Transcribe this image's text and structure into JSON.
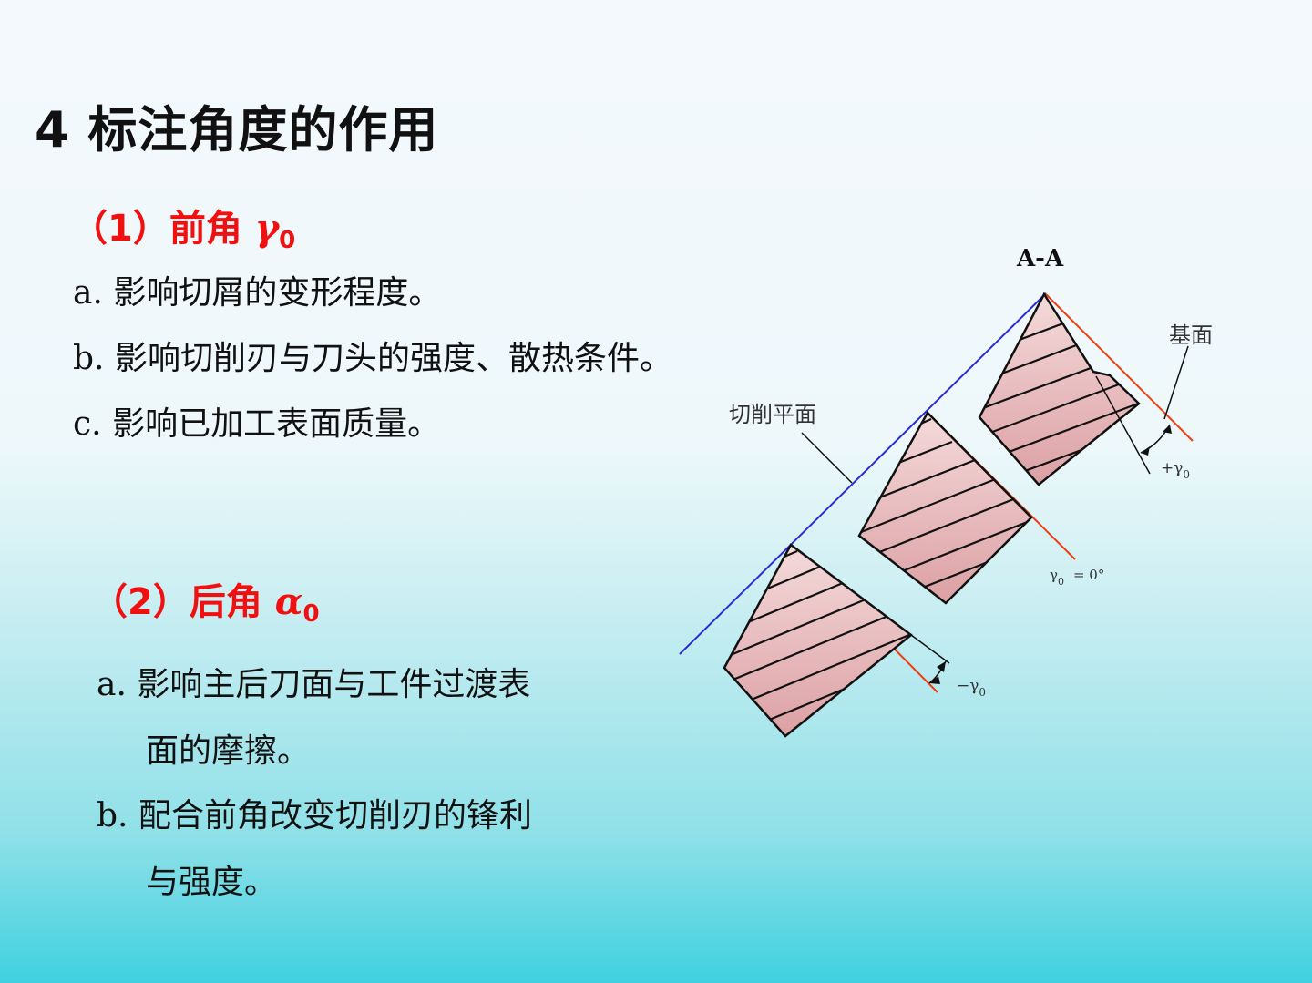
{
  "title": "4  标注角度的作用",
  "section1": {
    "label": "（1）前角 ",
    "symbol": "γ",
    "sub": "0"
  },
  "section1_items": [
    {
      "label": "a.",
      "text": "影响切屑的变形程度。"
    },
    {
      "label": "b.",
      "text": "影响切削刃与刀头的强度、散热条件。"
    },
    {
      "label": "c.",
      "text": "影响已加工表面质量。"
    }
  ],
  "section2": {
    "label": "（2）后角 ",
    "symbol": "α",
    "sub": "0"
  },
  "section2_items": [
    {
      "label": "a.",
      "line1": "影响主后刀面与工件过渡表",
      "line2": "面的摩擦。"
    },
    {
      "label": "b.",
      "line1": "配合前角改变切削刃的锋利",
      "line2": "与强度。"
    }
  ],
  "diagram": {
    "section_label": "A-A",
    "base_plane_label": "基面",
    "cutting_plane_label": "切削平面",
    "positive_rake_label": "+γ",
    "positive_rake_sub": "0",
    "zero_rake_label": "γ",
    "zero_rake_sub": "0",
    "zero_rake_value": "=   0°",
    "negative_rake_label": "−γ",
    "negative_rake_sub": "0",
    "colors": {
      "cutting_plane": "#2b2bd6",
      "base_plane": "#ef3d12",
      "tool_fill_top": "#f4dada",
      "tool_fill_bottom": "#dca0a4"
    }
  }
}
